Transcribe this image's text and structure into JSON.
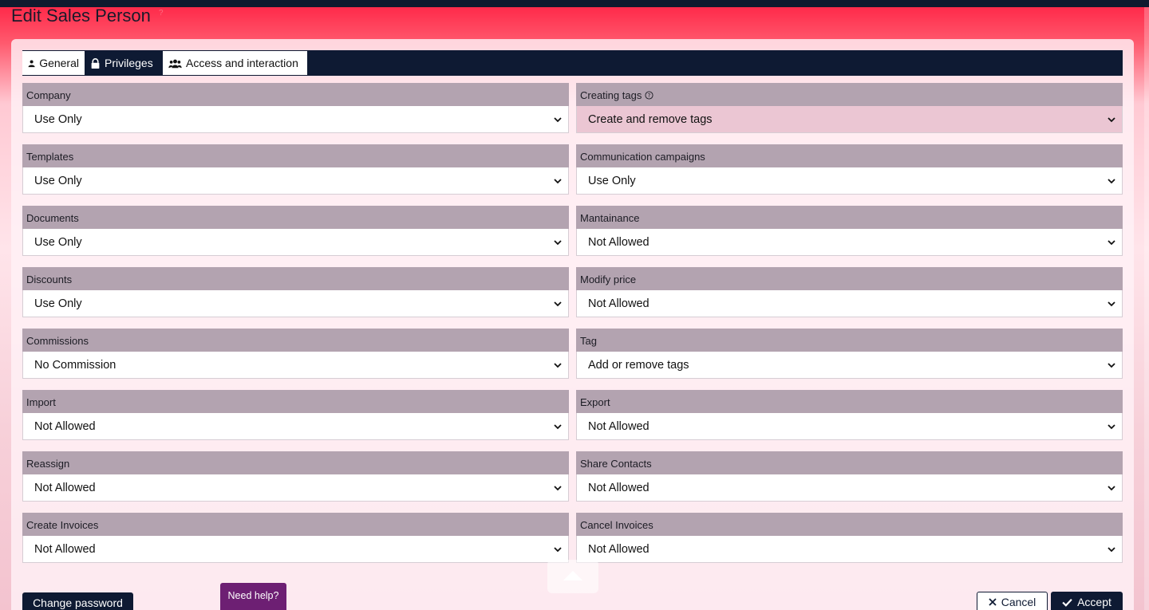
{
  "page": {
    "title": "Edit Sales Person",
    "title_help_icon": "help-circle-icon"
  },
  "tabs": [
    {
      "label": "General",
      "icon": "user-icon"
    },
    {
      "label": "Privileges",
      "icon": "lock-icon"
    },
    {
      "label": "Access and interaction",
      "icon": "users-icon"
    }
  ],
  "fields": {
    "company": {
      "label": "Company",
      "value": "Use Only"
    },
    "creating_tags": {
      "label": "Creating tags",
      "value": "Create and remove tags"
    },
    "templates": {
      "label": "Templates",
      "value": "Use Only"
    },
    "communication_campaigns": {
      "label": "Communication campaigns",
      "value": "Use Only"
    },
    "documents": {
      "label": "Documents",
      "value": "Use Only"
    },
    "mantainance": {
      "label": "Mantainance",
      "value": "Not Allowed"
    },
    "discounts": {
      "label": "Discounts",
      "value": "Use Only"
    },
    "modify_price": {
      "label": "Modify price",
      "value": "Not Allowed"
    },
    "commissions": {
      "label": "Commissions",
      "value": "No Commission"
    },
    "tag": {
      "label": "Tag",
      "value": "Add or remove tags"
    },
    "import": {
      "label": "Import",
      "value": "Not Allowed"
    },
    "export": {
      "label": "Export",
      "value": "Not Allowed"
    },
    "reassign": {
      "label": "Reassign",
      "value": "Not Allowed"
    },
    "share_contacts": {
      "label": "Share Contacts",
      "value": "Not Allowed"
    },
    "create_invoices": {
      "label": "Create Invoices",
      "value": "Not Allowed"
    },
    "cancel_invoices": {
      "label": "Cancel Invoices",
      "value": "Not Allowed"
    }
  },
  "buttons": {
    "change_password": "Change password",
    "need_help": "Need help?",
    "cancel": "Cancel",
    "accept": "Accept"
  },
  "colors": {
    "accent_dark": "#0e1a33",
    "label_bg": "#b3a3b0",
    "help_button": "#6d1f73",
    "tinted_select": "#ebc6d3"
  }
}
